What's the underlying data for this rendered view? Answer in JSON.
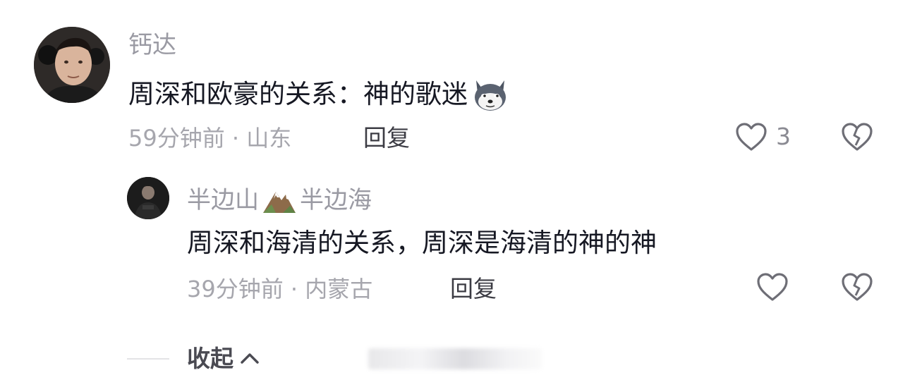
{
  "comment": {
    "username": "钙达",
    "text": "周深和欧豪的关系：神的歌迷",
    "emoji_icon": "husky-dog-emoji",
    "time": "59分钟前",
    "separator": "·",
    "location": "山东",
    "reply_label": "回复",
    "like_count": "3"
  },
  "reply": {
    "username_part1": "半边山",
    "username_icon": "mountain-emoji",
    "username_part2": "半边海",
    "text": "周深和海清的关系，周深是海清的神的神",
    "time": "39分钟前",
    "separator": "·",
    "location": "内蒙古",
    "reply_label": "回复"
  },
  "footer": {
    "collapse_label": "收起",
    "collapse_icon": "chevron-up-icon"
  },
  "colors": {
    "text_primary": "#161823",
    "text_secondary": "#a6a6ad",
    "icon_stroke": "#6e6e76"
  }
}
